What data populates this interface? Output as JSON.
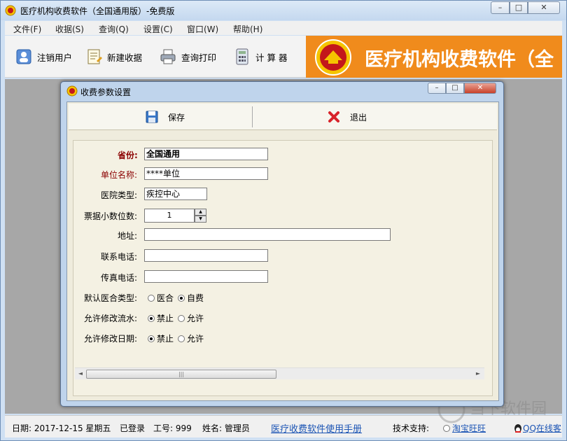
{
  "app": {
    "title": "医疗机构收费软件（全国通用版）-免费版",
    "banner_text": "医疗机构收费软件（全"
  },
  "window_controls": {
    "minimize": "–",
    "maximize": "□",
    "close": "✕"
  },
  "menu": [
    {
      "label": "文件(F)"
    },
    {
      "label": "收据(S)"
    },
    {
      "label": "查询(Q)"
    },
    {
      "label": "设置(C)"
    },
    {
      "label": "窗口(W)"
    },
    {
      "label": "帮助(H)"
    }
  ],
  "toolbar": [
    {
      "label": "注销用户",
      "icon": "user-logout-icon"
    },
    {
      "label": "新建收据",
      "icon": "new-receipt-icon"
    },
    {
      "label": "查询打印",
      "icon": "printer-icon"
    },
    {
      "label": "计 算 器",
      "icon": "calculator-icon"
    }
  ],
  "dialog": {
    "title": "收费参数设置",
    "save_label": "保存",
    "exit_label": "退出",
    "fields": {
      "province": {
        "label": "省份:",
        "value": "全国通用"
      },
      "unit_name": {
        "label": "单位名称:",
        "value": "****单位"
      },
      "hospital_type": {
        "label": "医院类型:",
        "value": "疾控中心"
      },
      "decimal_places": {
        "label": "票据小数位数:",
        "value": "1"
      },
      "address": {
        "label": "地址:",
        "value": ""
      },
      "phone": {
        "label": "联系电话:",
        "value": ""
      },
      "fax": {
        "label": "传真电话:",
        "value": ""
      }
    },
    "radios": {
      "default_type": {
        "label": "默认医合类型:",
        "options": [
          "医合",
          "自费"
        ],
        "selected": "自费"
      },
      "allow_edit_serial": {
        "label": "允许修改流水:",
        "options": [
          "禁止",
          "允许"
        ],
        "selected": "禁止"
      },
      "allow_edit_date": {
        "label": "允许修改日期:",
        "options": [
          "禁止",
          "允许"
        ],
        "selected": "禁止"
      }
    }
  },
  "status": {
    "date": "日期: 2017-12-15 星期五",
    "logged_in": "已登录",
    "job_no": "工号: 999",
    "name": "姓名: 管理员",
    "manual": "医疗收费软件使用手册",
    "support": "技术支持:",
    "taobao": "淘宝旺旺",
    "qq": "QQ在线客",
    "watermark": "当下软件园"
  },
  "colors": {
    "banner": "#f08b1c",
    "workspace": "#a7a7a7",
    "link": "#1b54b4",
    "required_label": "#8b0000"
  }
}
